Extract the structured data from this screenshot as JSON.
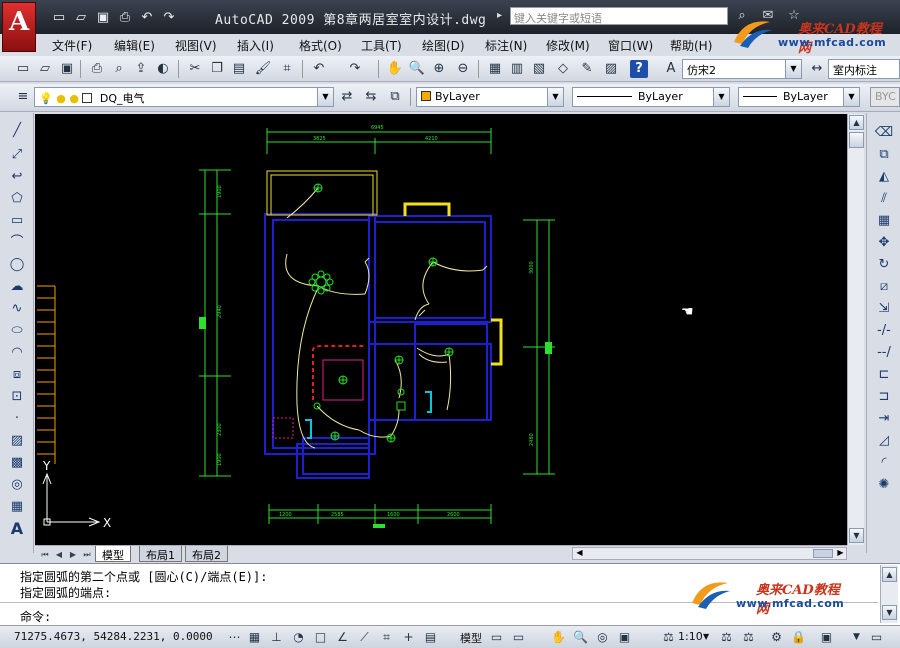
{
  "title_bar": {
    "app_logo": "A",
    "title": "AutoCAD 2009  第8章两居室室内设计.dwg",
    "search_placeholder": "键入关键字或短语"
  },
  "watermark": {
    "brand": "奥来CAD教程网",
    "url": "www.mfcad.com"
  },
  "menu": [
    "文件(F)",
    "编辑(E)",
    "视图(V)",
    "插入(I)",
    "格式(O)",
    "工具(T)",
    "绘图(D)",
    "标注(N)",
    "修改(M)",
    "窗口(W)",
    "帮助(H)"
  ],
  "styles_toolbar": {
    "text_style": "仿宋2",
    "dim_style": "室内标注"
  },
  "layers_toolbar": {
    "layer": "DQ_电气",
    "color": "ByLayer",
    "linetype": "ByLayer",
    "lineweight": "ByLayer",
    "plot_style": "BYC"
  },
  "layout_tabs": [
    "模型",
    "布局1",
    "布局2"
  ],
  "command_history": [
    "指定圆弧的第二个点或 [圆心(C)/端点(E)]:",
    "指定圆弧的端点:"
  ],
  "command_prompt": "命令:",
  "status": {
    "coords": "71275.4673, 54284.2231, 0.0000",
    "model_label": "模型",
    "scale_label": "1:10"
  },
  "ucs": {
    "x_label": "X",
    "y_label": "Y"
  },
  "drawing": {
    "dim_top_total": "6945",
    "dim_top_segments": [
      "3825",
      "4210"
    ],
    "dim_bottom": [
      "1200",
      "2585",
      "1600",
      "2600"
    ],
    "dim_left": [
      "1900",
      "2940",
      "2300",
      "1900"
    ],
    "dim_right": [
      "3000",
      "2480"
    ]
  },
  "colors": {
    "canvas_bg": "#000000",
    "walls": "#1f1fd2",
    "dimensions": "#2ee02e",
    "wiring": "#f2e8a0",
    "fixtures": "#24e024",
    "doors": "#f0e020",
    "magenta": "#e0208c",
    "red_hatch": "#e0201c"
  }
}
